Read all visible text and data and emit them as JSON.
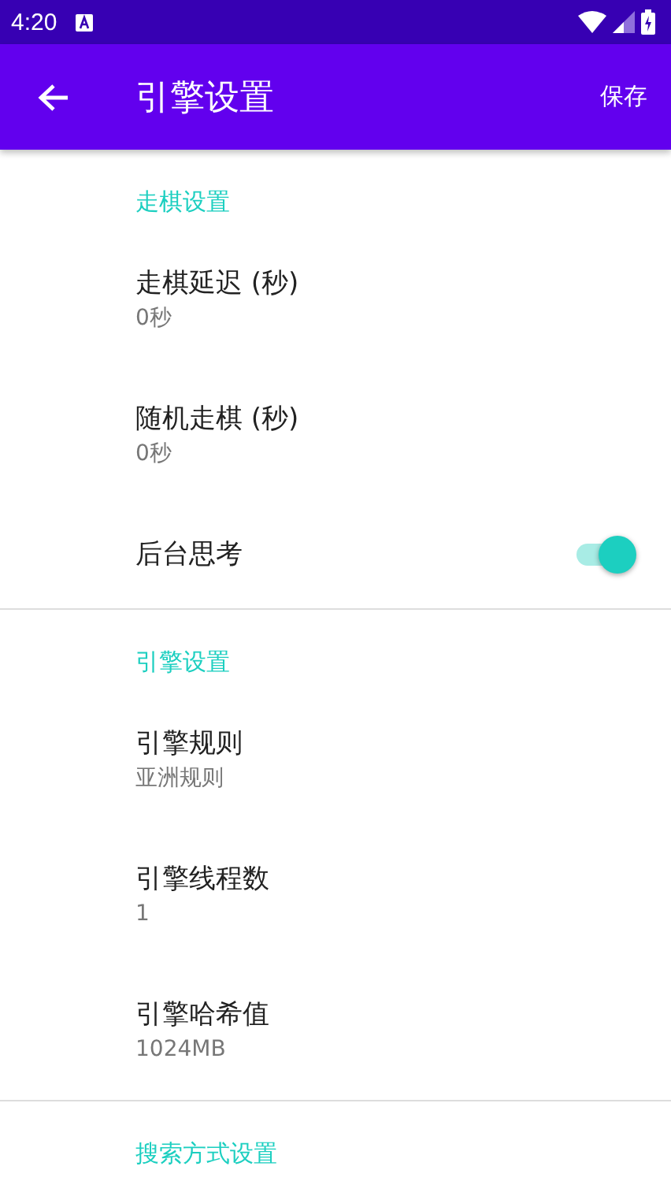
{
  "status_bar": {
    "time": "4:20"
  },
  "toolbar": {
    "title": "引擎设置",
    "action": "保存"
  },
  "sections": [
    {
      "header": "走棋设置",
      "items": [
        {
          "kind": "text",
          "title": "走棋延迟 (秒)",
          "summary": "0秒"
        },
        {
          "kind": "text",
          "title": "随机走棋 (秒)",
          "summary": "0秒"
        },
        {
          "kind": "switch",
          "title": "后台思考",
          "on": true
        }
      ]
    },
    {
      "header": "引擎设置",
      "items": [
        {
          "kind": "text",
          "title": "引擎规则",
          "summary": "亚洲规则"
        },
        {
          "kind": "text",
          "title": "引擎线程数",
          "summary": "1"
        },
        {
          "kind": "text",
          "title": "引擎哈希值",
          "summary": "1024MB"
        }
      ]
    },
    {
      "header": "搜索方式设置"
    }
  ]
}
